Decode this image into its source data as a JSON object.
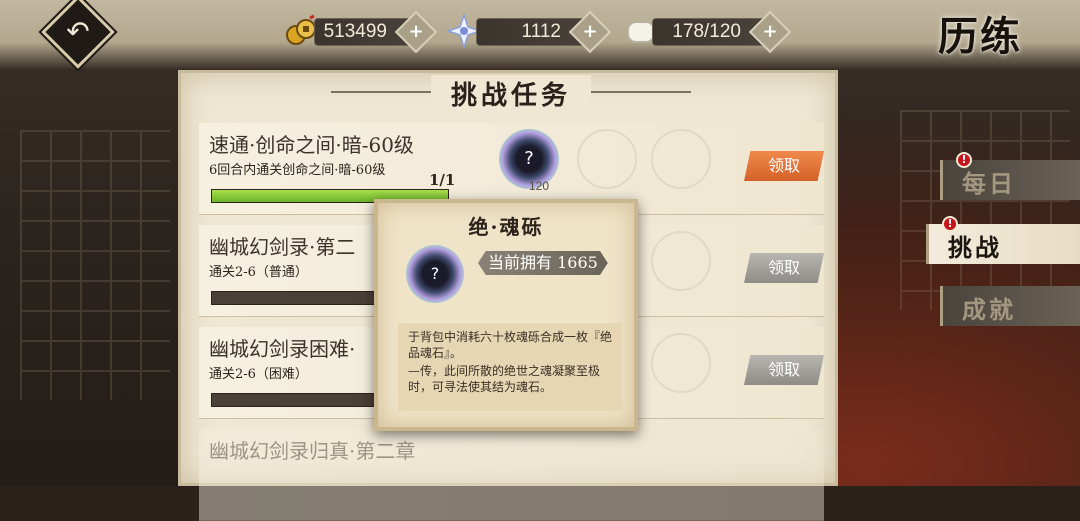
{
  "header": {
    "title": "历练",
    "resources": [
      {
        "name": "gold",
        "value": "513499",
        "icon": "coin-icon"
      },
      {
        "name": "star",
        "value": "1112",
        "icon": "star-icon"
      },
      {
        "name": "stamina",
        "value": "178/120",
        "icon": "tofu-icon"
      }
    ]
  },
  "board": {
    "title": "挑战任务",
    "tasks": [
      {
        "name": "速通·创命之间·暗-60级",
        "desc": "6回合内通关创命之间·暗-60级",
        "count": "1/1",
        "progress": 1.0,
        "reward_count": "120",
        "claim": "领取",
        "claim_state": "active"
      },
      {
        "name": "幽城幻剑录·第二",
        "desc": "通关2-6（普通）",
        "count": "",
        "progress": 0,
        "reward_count": "",
        "claim": "领取",
        "claim_state": "disabled"
      },
      {
        "name": "幽城幻剑录困难·",
        "desc": "通关2-6（困难）",
        "count": "",
        "progress": 0,
        "reward_count": "",
        "claim": "领取",
        "claim_state": "disabled"
      },
      {
        "name": "幽城幻剑录归真·第二章",
        "desc": "",
        "count": "",
        "progress": 0,
        "reward_count": "",
        "claim": "",
        "claim_state": "hidden"
      }
    ]
  },
  "tabs": [
    {
      "label": "每日",
      "badge": "!",
      "active": false
    },
    {
      "label": "挑战",
      "badge": "!",
      "active": true
    },
    {
      "label": "成就",
      "badge": "",
      "active": false
    }
  ],
  "tooltip": {
    "title": "绝·魂砾",
    "owned": "当前拥有 1665",
    "desc1": "于背包中消耗六十枚魂砾合成一枚『绝品魂石』。",
    "desc2": "—传，此间所散的绝世之魂凝聚至极时，可寻法使其结为魂石。",
    "item_glyph": "?"
  },
  "nav": {
    "back_glyph": "↶"
  },
  "colors": {
    "claim_active": "#e0763a",
    "progress_fill": "#8fd03a",
    "badge": "#c4151c"
  }
}
